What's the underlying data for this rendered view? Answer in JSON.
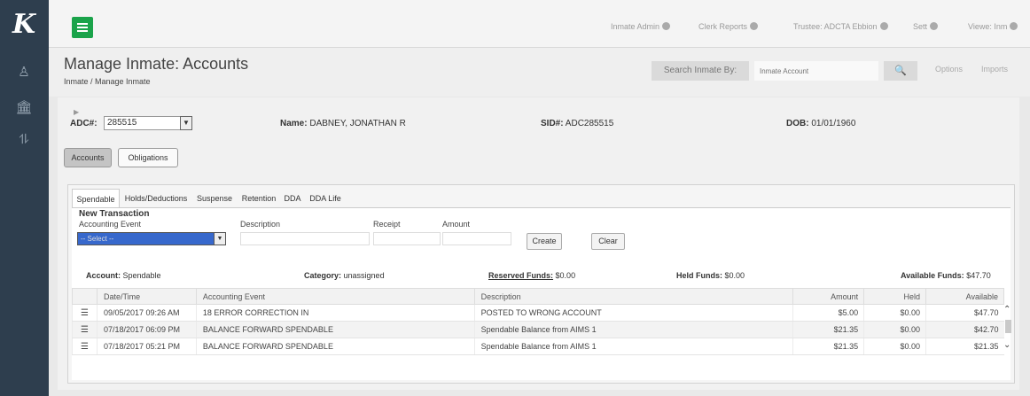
{
  "app": {
    "logo": "K"
  },
  "sidebar": {
    "items": [
      {
        "icon": "user-icon",
        "glyph": "♙"
      },
      {
        "icon": "institution-icon",
        "glyph": "🏛"
      },
      {
        "icon": "filter-list-icon",
        "glyph": "⥮"
      }
    ]
  },
  "topbar": {
    "links": [
      {
        "label": "Inmate Admin",
        "icon": "gear-icon"
      },
      {
        "label": "Clerk Reports",
        "icon": "info-icon"
      },
      {
        "label": "Trustee: ADCTA Ebbion",
        "icon": "wrench-icon"
      },
      {
        "label": "Sett",
        "icon": "globe-icon"
      },
      {
        "label": "Viewe: Inm",
        "icon": "user-icon"
      }
    ]
  },
  "header": {
    "title": "Manage Inmate: Accounts",
    "breadcrumb": "Inmate / Manage Inmate",
    "search_label": "Search Inmate By:",
    "search_placeholder": "Inmate Account",
    "search_button": "🔍",
    "links": [
      "Options",
      "Imports"
    ]
  },
  "inmate": {
    "adc_label": "ADC#:",
    "adc_value": "285515",
    "name_label": "Name:",
    "name_value": "DABNEY, JONATHAN R",
    "sid_label": "SID#:",
    "sid_value": "ADC285515",
    "dob_label": "DOB:",
    "dob_value": "01/01/1960"
  },
  "section_buttons": [
    "Accounts",
    "Obligations"
  ],
  "tabs": [
    "Spendable",
    "Holds/Deductions",
    "Suspense",
    "Retention",
    "DDA",
    "DDA Life"
  ],
  "new_transaction": {
    "title": "New Transaction",
    "labels": {
      "event": "Accounting Event",
      "description": "Description",
      "receipt": "Receipt",
      "amount": "Amount"
    },
    "select_value": "-- Select --",
    "create": "Create",
    "clear": "Clear"
  },
  "account_summary": {
    "account_label": "Account:",
    "account_value": "Spendable",
    "category_label": "Category:",
    "category_value": "unassigned",
    "reserved_label": "Reserved Funds:",
    "reserved_value": "$0.00",
    "held_label": "Held Funds:",
    "held_value": "$0.00",
    "available_label": "Available Funds:",
    "available_value": "$47.70"
  },
  "table": {
    "columns": [
      "Date/Time",
      "Accounting Event",
      "Description",
      "Amount",
      "Held",
      "Available"
    ],
    "rows": [
      {
        "datetime": "09/05/2017 09:26 AM",
        "event": "18 ERROR CORRECTION IN",
        "description": "POSTED TO WRONG ACCOUNT",
        "amount": "$5.00",
        "held": "$0.00",
        "available": "$47.70"
      },
      {
        "datetime": "07/18/2017 06:09 PM",
        "event": "BALANCE FORWARD SPENDABLE",
        "description": "Spendable Balance from AIMS 1",
        "amount": "$21.35",
        "held": "$0.00",
        "available": "$42.70"
      },
      {
        "datetime": "07/18/2017 05:21 PM",
        "event": "BALANCE FORWARD SPENDABLE",
        "description": "Spendable Balance from AIMS 1",
        "amount": "$21.35",
        "held": "$0.00",
        "available": "$21.35"
      }
    ]
  }
}
